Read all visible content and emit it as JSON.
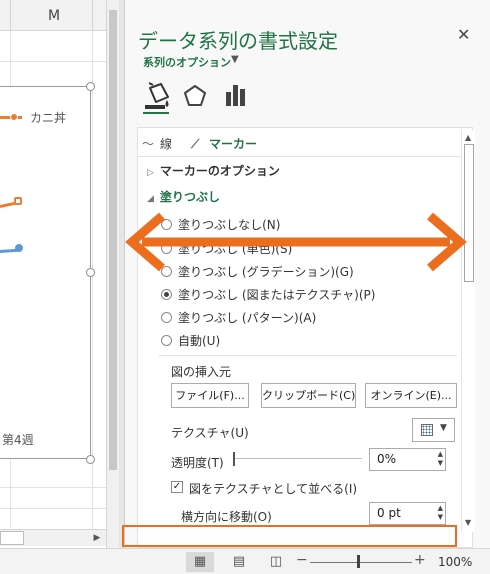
{
  "sheet": {
    "column_label": "M",
    "legend_label": "カニ丼",
    "axis_label": "第4週"
  },
  "pane": {
    "title": "データ系列の書式設定",
    "close": "✕",
    "series_options": "系列のオプション",
    "subtabs": {
      "line": "線",
      "marker": "マーカー"
    },
    "sections": {
      "marker_options": "マーカーのオプション",
      "fill": "塗りつぶし"
    },
    "fill_options": [
      "塗りつぶしなし(N)",
      "塗りつぶし (単色)(S)",
      "塗りつぶし (グラデーション)(G)",
      "塗りつぶし (図またはテクスチャ)(P)",
      "塗りつぶし (パターン)(A)",
      "自動(U)"
    ],
    "selected_fill_index": 3,
    "insert_from_label": "図の挿入元",
    "buttons": {
      "file": "ファイル(F)...",
      "clipboard": "クリップボード(C)",
      "online": "オンライン(E)..."
    },
    "texture_label": "テクスチャ(U)",
    "transparency_label": "透明度(T)",
    "transparency_value": "0%",
    "tile_label": "図をテクスチャとして並べる(I)",
    "tile_checked": true,
    "offset_x_label": "横方向に移動(O)",
    "offset_x_value": "0 pt"
  },
  "status": {
    "zoom": "100%"
  },
  "colors": {
    "accent": "#217346",
    "series_orange": "#ed7d31",
    "series_blue": "#5b9bd5",
    "annotation": "#ed6d1f"
  },
  "icons": {
    "fill": "fill-and-line-icon",
    "effects": "effects-pentagon-icon",
    "series_options": "series-options-bars-icon"
  }
}
